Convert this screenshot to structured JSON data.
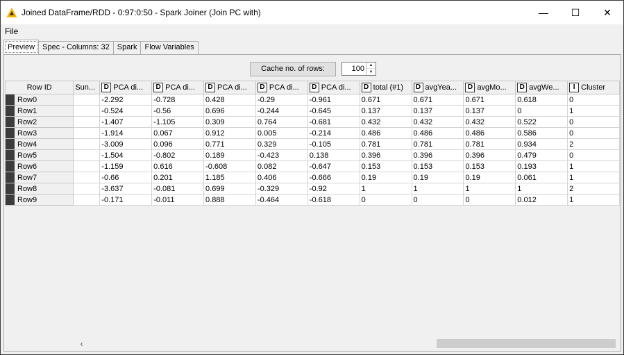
{
  "window": {
    "title": "Joined DataFrame/RDD - 0:97:0:50 - Spark Joiner (Join PC with)",
    "minimize_glyph": "—",
    "maximize_glyph": "☐",
    "close_glyph": "✕"
  },
  "menu": {
    "file": "File"
  },
  "tabs": [
    {
      "label": "Preview",
      "active": true
    },
    {
      "label": "Spec - Columns: 32",
      "active": false
    },
    {
      "label": "Spark",
      "active": false
    },
    {
      "label": "Flow Variables",
      "active": false
    }
  ],
  "cache": {
    "button_label": "Cache no. of rows:",
    "value": "100"
  },
  "table": {
    "columns": [
      {
        "label": "Row ID",
        "type": "",
        "width": 99
      },
      {
        "label": "Sun...",
        "type": "",
        "width": 38
      },
      {
        "label": "PCA di...",
        "type": "D",
        "width": 75
      },
      {
        "label": "PCA di...",
        "type": "D",
        "width": 75
      },
      {
        "label": "PCA di...",
        "type": "D",
        "width": 75
      },
      {
        "label": "PCA di...",
        "type": "D",
        "width": 75
      },
      {
        "label": "PCA di...",
        "type": "D",
        "width": 75
      },
      {
        "label": "total (#1)",
        "type": "D",
        "width": 75
      },
      {
        "label": "avgYea...",
        "type": "D",
        "width": 75
      },
      {
        "label": "avgMo...",
        "type": "D",
        "width": 75
      },
      {
        "label": "avgWe...",
        "type": "D",
        "width": 75
      },
      {
        "label": "Cluster",
        "type": "I",
        "width": 75
      }
    ],
    "rows": [
      [
        "Row0",
        "",
        "-2.292",
        "-0.728",
        "0.428",
        "-0.29",
        "-0.961",
        "0.671",
        "0.671",
        "0.671",
        "0.618",
        "0"
      ],
      [
        "Row1",
        "",
        "-0.524",
        "-0.56",
        "0.696",
        "-0.244",
        "-0.645",
        "0.137",
        "0.137",
        "0.137",
        "0",
        "1"
      ],
      [
        "Row2",
        "",
        "-1.407",
        "-1.105",
        "0.309",
        "0.764",
        "-0.681",
        "0.432",
        "0.432",
        "0.432",
        "0.522",
        "0"
      ],
      [
        "Row3",
        "",
        "-1.914",
        "0.067",
        "0.912",
        "0.005",
        "-0.214",
        "0.486",
        "0.486",
        "0.486",
        "0.586",
        "0"
      ],
      [
        "Row4",
        "",
        "-3.009",
        "0.096",
        "0.771",
        "0.329",
        "-0.105",
        "0.781",
        "0.781",
        "0.781",
        "0.934",
        "2"
      ],
      [
        "Row5",
        "",
        "-1.504",
        "-0.802",
        "0.189",
        "-0.423",
        "0.138",
        "0.396",
        "0.396",
        "0.396",
        "0.479",
        "0"
      ],
      [
        "Row6",
        "",
        "-1.159",
        "0.616",
        "-0.608",
        "0.082",
        "-0.647",
        "0.153",
        "0.153",
        "0.153",
        "0.193",
        "1"
      ],
      [
        "Row7",
        "",
        "-0.66",
        "0.201",
        "1.185",
        "0.406",
        "-0.666",
        "0.19",
        "0.19",
        "0.19",
        "0.061",
        "1"
      ],
      [
        "Row8",
        "",
        "-3.637",
        "-0.081",
        "0.699",
        "-0.329",
        "-0.92",
        "1",
        "1",
        "1",
        "1",
        "2"
      ],
      [
        "Row9",
        "",
        "-0.171",
        "-0.011",
        "0.888",
        "-0.464",
        "-0.618",
        "0",
        "0",
        "0",
        "0.012",
        "1"
      ]
    ]
  },
  "scrollbar": {
    "left_glyph": "‹",
    "right_glyph": "›"
  },
  "colors": {
    "accent_yellow": "#f5b400",
    "row_marker": "#3c3c3c"
  }
}
